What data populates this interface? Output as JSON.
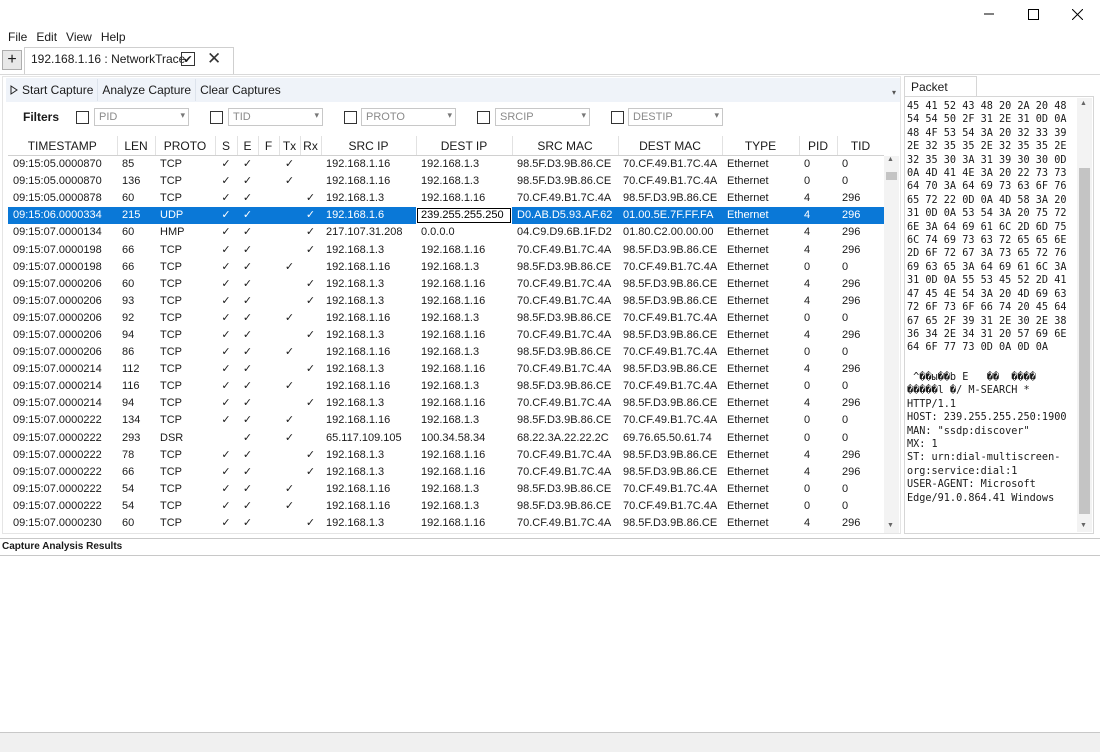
{
  "menu": [
    "File",
    "Edit",
    "View",
    "Help"
  ],
  "tab": {
    "label": "192.168.1.16 : NetworkTrace"
  },
  "toolbar": {
    "start": "Start Capture",
    "analyze": "Analyze Capture",
    "clear": "Clear Captures"
  },
  "filters": {
    "label": "Filters",
    "pid": "PID",
    "tid": "TID",
    "proto": "PROTO",
    "srcip": "SRCIP",
    "destip": "DESTIP"
  },
  "columns": [
    "TIMESTAMP",
    "LEN",
    "PROTO",
    "S",
    "E",
    "F",
    "Tx",
    "Rx",
    "SRC IP",
    "DEST IP",
    "SRC MAC",
    "DEST MAC",
    "TYPE",
    "PID",
    "TID"
  ],
  "rows": [
    [
      "09:15:05.0000870",
      "85",
      "TCP",
      "✓",
      "✓",
      "",
      "✓",
      "",
      "192.168.1.16",
      "192.168.1.3",
      "98.5F.D3.9B.86.CE",
      "70.CF.49.B1.7C.4A",
      "Ethernet",
      "0",
      "0"
    ],
    [
      "09:15:05.0000870",
      "136",
      "TCP",
      "✓",
      "✓",
      "",
      "✓",
      "",
      "192.168.1.16",
      "192.168.1.3",
      "98.5F.D3.9B.86.CE",
      "70.CF.49.B1.7C.4A",
      "Ethernet",
      "0",
      "0"
    ],
    [
      "09:15:05.0000878",
      "60",
      "TCP",
      "✓",
      "✓",
      "",
      "",
      "✓",
      "192.168.1.3",
      "192.168.1.16",
      "70.CF.49.B1.7C.4A",
      "98.5F.D3.9B.86.CE",
      "Ethernet",
      "4",
      "296"
    ],
    [
      "09:15:06.0000334",
      "215",
      "UDP",
      "✓",
      "✓",
      "",
      "",
      "✓",
      "192.168.1.6",
      "239.255.255.250",
      "D0.AB.D5.93.AF.62",
      "01.00.5E.7F.FF.FA",
      "Ethernet",
      "4",
      "296"
    ],
    [
      "09:15:07.0000134",
      "60",
      "HMP",
      "✓",
      "✓",
      "",
      "",
      "✓",
      "217.107.31.208",
      "0.0.0.0",
      "04.C9.D9.6B.1F.D2",
      "01.80.C2.00.00.00",
      "Ethernet",
      "4",
      "296"
    ],
    [
      "09:15:07.0000198",
      "66",
      "TCP",
      "✓",
      "✓",
      "",
      "",
      "✓",
      "192.168.1.3",
      "192.168.1.16",
      "70.CF.49.B1.7C.4A",
      "98.5F.D3.9B.86.CE",
      "Ethernet",
      "4",
      "296"
    ],
    [
      "09:15:07.0000198",
      "66",
      "TCP",
      "✓",
      "✓",
      "",
      "✓",
      "",
      "192.168.1.16",
      "192.168.1.3",
      "98.5F.D3.9B.86.CE",
      "70.CF.49.B1.7C.4A",
      "Ethernet",
      "0",
      "0"
    ],
    [
      "09:15:07.0000206",
      "60",
      "TCP",
      "✓",
      "✓",
      "",
      "",
      "✓",
      "192.168.1.3",
      "192.168.1.16",
      "70.CF.49.B1.7C.4A",
      "98.5F.D3.9B.86.CE",
      "Ethernet",
      "4",
      "296"
    ],
    [
      "09:15:07.0000206",
      "93",
      "TCP",
      "✓",
      "✓",
      "",
      "",
      "✓",
      "192.168.1.3",
      "192.168.1.16",
      "70.CF.49.B1.7C.4A",
      "98.5F.D3.9B.86.CE",
      "Ethernet",
      "4",
      "296"
    ],
    [
      "09:15:07.0000206",
      "92",
      "TCP",
      "✓",
      "✓",
      "",
      "✓",
      "",
      "192.168.1.16",
      "192.168.1.3",
      "98.5F.D3.9B.86.CE",
      "70.CF.49.B1.7C.4A",
      "Ethernet",
      "0",
      "0"
    ],
    [
      "09:15:07.0000206",
      "94",
      "TCP",
      "✓",
      "✓",
      "",
      "",
      "✓",
      "192.168.1.3",
      "192.168.1.16",
      "70.CF.49.B1.7C.4A",
      "98.5F.D3.9B.86.CE",
      "Ethernet",
      "4",
      "296"
    ],
    [
      "09:15:07.0000206",
      "86",
      "TCP",
      "✓",
      "✓",
      "",
      "✓",
      "",
      "192.168.1.16",
      "192.168.1.3",
      "98.5F.D3.9B.86.CE",
      "70.CF.49.B1.7C.4A",
      "Ethernet",
      "0",
      "0"
    ],
    [
      "09:15:07.0000214",
      "112",
      "TCP",
      "✓",
      "✓",
      "",
      "",
      "✓",
      "192.168.1.3",
      "192.168.1.16",
      "70.CF.49.B1.7C.4A",
      "98.5F.D3.9B.86.CE",
      "Ethernet",
      "4",
      "296"
    ],
    [
      "09:15:07.0000214",
      "116",
      "TCP",
      "✓",
      "✓",
      "",
      "✓",
      "",
      "192.168.1.16",
      "192.168.1.3",
      "98.5F.D3.9B.86.CE",
      "70.CF.49.B1.7C.4A",
      "Ethernet",
      "0",
      "0"
    ],
    [
      "09:15:07.0000214",
      "94",
      "TCP",
      "✓",
      "✓",
      "",
      "",
      "✓",
      "192.168.1.3",
      "192.168.1.16",
      "70.CF.49.B1.7C.4A",
      "98.5F.D3.9B.86.CE",
      "Ethernet",
      "4",
      "296"
    ],
    [
      "09:15:07.0000222",
      "134",
      "TCP",
      "✓",
      "✓",
      "",
      "✓",
      "",
      "192.168.1.16",
      "192.168.1.3",
      "98.5F.D3.9B.86.CE",
      "70.CF.49.B1.7C.4A",
      "Ethernet",
      "0",
      "0"
    ],
    [
      "09:15:07.0000222",
      "293",
      "DSR",
      "",
      "✓",
      "",
      "✓",
      "",
      "65.117.109.105",
      "100.34.58.34",
      "68.22.3A.22.22.2C",
      "69.76.65.50.61.74",
      "Ethernet",
      "0",
      "0"
    ],
    [
      "09:15:07.0000222",
      "78",
      "TCP",
      "✓",
      "✓",
      "",
      "",
      "✓",
      "192.168.1.3",
      "192.168.1.16",
      "70.CF.49.B1.7C.4A",
      "98.5F.D3.9B.86.CE",
      "Ethernet",
      "4",
      "296"
    ],
    [
      "09:15:07.0000222",
      "66",
      "TCP",
      "✓",
      "✓",
      "",
      "",
      "✓",
      "192.168.1.3",
      "192.168.1.16",
      "70.CF.49.B1.7C.4A",
      "98.5F.D3.9B.86.CE",
      "Ethernet",
      "4",
      "296"
    ],
    [
      "09:15:07.0000222",
      "54",
      "TCP",
      "✓",
      "✓",
      "",
      "✓",
      "",
      "192.168.1.16",
      "192.168.1.3",
      "98.5F.D3.9B.86.CE",
      "70.CF.49.B1.7C.4A",
      "Ethernet",
      "0",
      "0"
    ],
    [
      "09:15:07.0000222",
      "54",
      "TCP",
      "✓",
      "✓",
      "",
      "✓",
      "",
      "192.168.1.16",
      "192.168.1.3",
      "98.5F.D3.9B.86.CE",
      "70.CF.49.B1.7C.4A",
      "Ethernet",
      "0",
      "0"
    ],
    [
      "09:15:07.0000230",
      "60",
      "TCP",
      "✓",
      "✓",
      "",
      "",
      "✓",
      "192.168.1.3",
      "192.168.1.16",
      "70.CF.49.B1.7C.4A",
      "98.5F.D3.9B.86.CE",
      "Ethernet",
      "4",
      "296"
    ]
  ],
  "selected_row": 3,
  "focused_cell": 9,
  "packet": {
    "tab_label": "Packet Data",
    "hex": "45 41 52 43 48 20 2A 20 48\n54 54 50 2F 31 2E 31 0D 0A\n48 4F 53 54 3A 20 32 33 39\n2E 32 35 35 2E 32 35 35 2E\n32 35 30 3A 31 39 30 30 0D\n0A 4D 41 4E 3A 20 22 73 73\n64 70 3A 64 69 73 63 6F 76\n65 72 22 0D 0A 4D 58 3A 20\n31 0D 0A 53 54 3A 20 75 72\n6E 3A 64 69 61 6C 2D 6D 75\n6C 74 69 73 63 72 65 65 6E\n2D 6F 72 67 3A 73 65 72 76\n69 63 65 3A 64 69 61 6C 3A\n31 0D 0A 55 53 45 52 2D 41\n47 45 4E 54 3A 20 4D 69 63\n72 6F 73 6F 66 74 20 45 64\n67 65 2F 39 31 2E 30 2E 38\n36 34 2E 34 31 20 57 69 6E\n64 6F 77 73 0D 0A 0D 0A",
    "ascii": " ^��ы��b E   ��  ����\n�����l �/ M-SEARCH *\nHTTP/1.1\nHOST: 239.255.255.250:1900\nMAN: \"ssdp:discover\"\nMX: 1\nST: urn:dial-multiscreen-\norg:service:dial:1\nUSER-AGENT: Microsoft\nEdge/91.0.864.41 Windows"
  },
  "results": {
    "title": "Capture Analysis Results"
  },
  "colors": {
    "selection": "#0a78d7",
    "toolbar_bg": "#eff3f9"
  }
}
